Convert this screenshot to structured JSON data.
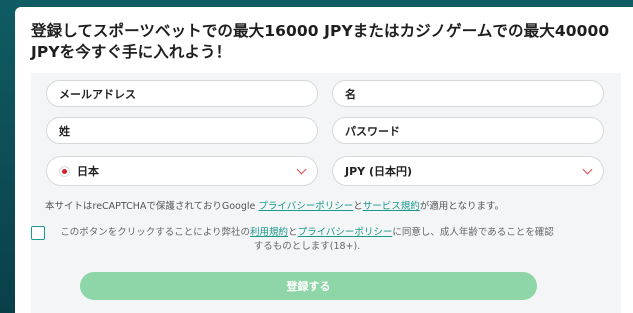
{
  "header": {
    "title": "登録してスポーツベットでの最大16000 JPYまたはカジノゲームでの最大40000 JPYを今すぐ手に入れよう！"
  },
  "form": {
    "email_placeholder": "メールアドレス",
    "first_name_placeholder": "名",
    "last_name_placeholder": "姓",
    "password_placeholder": "パスワード",
    "country_value": "日本",
    "currency_value": "JPY (日本円)"
  },
  "recaptcha": {
    "prefix": "本サイトはreCAPTCHAで保護されておりGoogle ",
    "privacy_link": "プライバシーポリシー",
    "and": "と",
    "terms_link": "サービス規約",
    "suffix": "が適用となります。"
  },
  "consent": {
    "prefix": "このボタンをクリックすることにより弊社の",
    "terms_link": "利用規約",
    "and": "と",
    "privacy_link": "プライバシーポリシー",
    "suffix": "に同意し、成人年齢であることを確認するものとします(18+)."
  },
  "submit_label": "登録する",
  "colors": {
    "accent": "#1a9a8a",
    "submit_bg": "#8ed6a7",
    "backdrop": "#0f5c64"
  },
  "icons": {
    "country_flag": "japan-flag-icon",
    "dropdown": "chevron-down-icon"
  }
}
